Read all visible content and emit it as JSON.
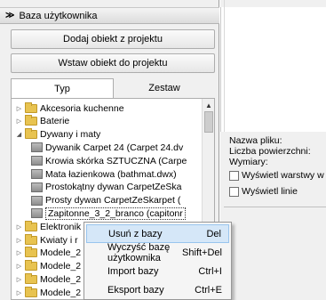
{
  "panel": {
    "header": "Baza użytkownika",
    "add_button": "Dodaj obiekt z projektu",
    "insert_button": "Wstaw obiekt do projektu",
    "tabs": [
      "Typ",
      "Zestaw"
    ]
  },
  "tree": [
    {
      "label": "Akcesoria kuchenne",
      "level": 0,
      "kind": "folder",
      "expander": "▷"
    },
    {
      "label": "Baterie",
      "level": 0,
      "kind": "folder",
      "expander": "▷"
    },
    {
      "label": "Dywany i maty",
      "level": 0,
      "kind": "folder",
      "expander": "◢"
    },
    {
      "label": "Dywanik Carpet 24 (Carpet 24.dv",
      "level": 1,
      "kind": "item"
    },
    {
      "label": "Krowia skórka SZTUCZNA (Carpe",
      "level": 1,
      "kind": "item"
    },
    {
      "label": "Mata łazienkowa (bathmat.dwx)",
      "level": 1,
      "kind": "item"
    },
    {
      "label": "Prostokątny dywan CarpetZeSka",
      "level": 1,
      "kind": "item"
    },
    {
      "label": "Prosty dywan CarpetZeSkarpet (",
      "level": 1,
      "kind": "item"
    },
    {
      "label": "Zapitonne_3_2_branco (capitonr",
      "level": 1,
      "kind": "item",
      "selected": true
    },
    {
      "label": "Elektronik",
      "level": 0,
      "kind": "folder",
      "expander": "▷"
    },
    {
      "label": "Kwiaty i r",
      "level": 0,
      "kind": "folder",
      "expander": "▷"
    },
    {
      "label": "Modele_2",
      "level": 0,
      "kind": "folder",
      "expander": "▷"
    },
    {
      "label": "Modele_2",
      "level": 0,
      "kind": "folder",
      "expander": "▷"
    },
    {
      "label": "Modele_2",
      "level": 0,
      "kind": "folder",
      "expander": "▷"
    },
    {
      "label": "Modele_2",
      "level": 0,
      "kind": "folder",
      "expander": "▷"
    }
  ],
  "properties": {
    "file_name": "Nazwa pliku:",
    "surface_count": "Liczba powierzchni:",
    "dimensions": "Wymiary:",
    "show_layers": "Wyświetl warstwy w",
    "show_lines": "Wyświetl linie"
  },
  "context_menu": [
    {
      "label": "Usuń z bazy",
      "shortcut": "Del",
      "hover": true
    },
    {
      "label": "Wyczyść bazę użytkownika",
      "shortcut": "Shift+Del"
    },
    {
      "label": "Import bazy",
      "shortcut": "Ctrl+I"
    },
    {
      "label": "Eksport bazy",
      "shortcut": "Ctrl+E"
    }
  ]
}
